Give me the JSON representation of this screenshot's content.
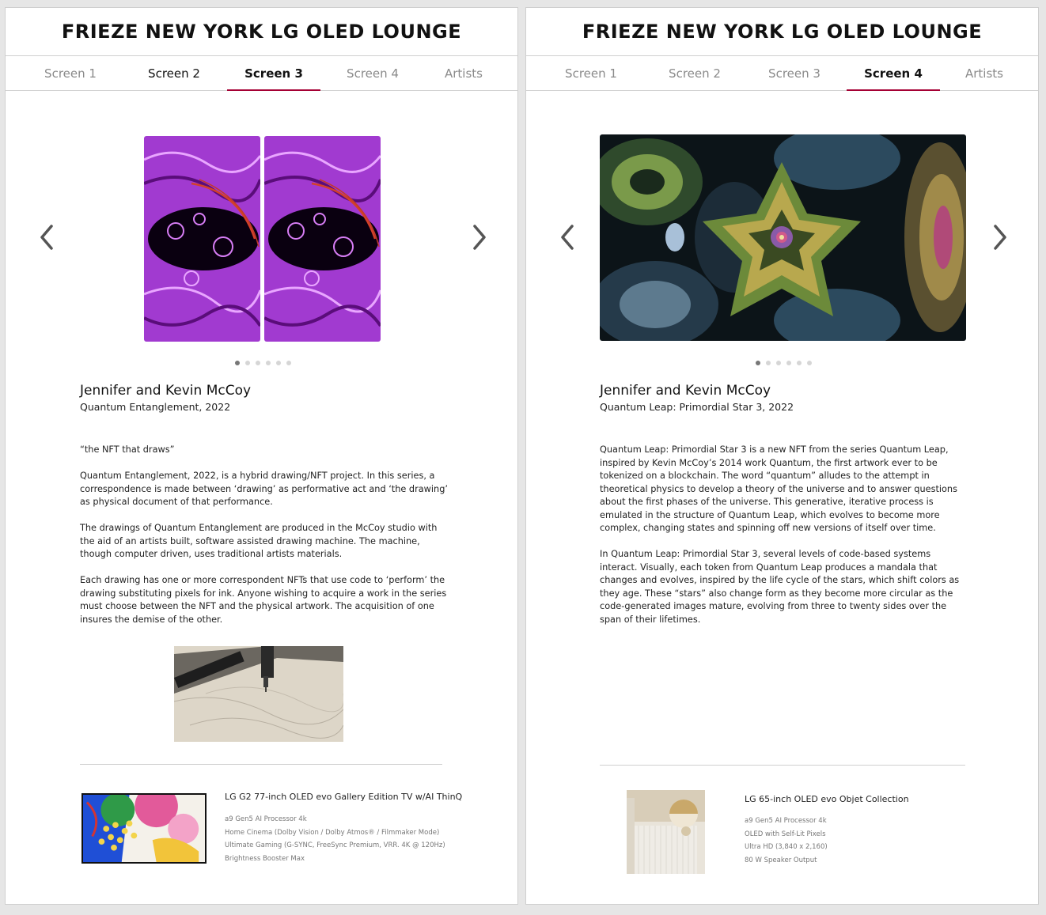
{
  "panels": [
    {
      "title": "FRIEZE NEW YORK LG OLED LOUNGE",
      "tabs": [
        "Screen 1",
        "Screen 2",
        "Screen 3",
        "Screen 4",
        "Artists"
      ],
      "active_tab": "Screen 3",
      "carousel": {
        "total": 6,
        "current": 1
      },
      "artist": "Jennifer and Kevin McCoy",
      "work": "Quantum Entanglement, 2022",
      "description": [
        "“the NFT that draws”",
        "Quantum Entanglement, 2022, is a hybrid drawing/NFT project. In this series, a correspondence is made between ‘drawing’ as performative act and ‘the drawing’ as physical document of that performance.",
        "The drawings of Quantum Entanglement are produced in the McCoy studio with the aid of an artists built, software assisted drawing machine. The machine, though computer driven, uses traditional artists materials.",
        "Each drawing has one or more correspondent NFTs that use code to ‘perform’ the drawing substituting pixels for ink. Anyone wishing to acquire a work in the series must choose between the NFT and the physical artwork. The acquisition of one insures the demise of the other."
      ],
      "product": {
        "name": "LG G2 77-inch OLED evo Gallery Edition TV w/AI ThinQ",
        "specs": [
          "a9 Gen5 AI Processor 4k",
          "Home Cinema (Dolby Vision / Dolby Atmos® / Filmmaker Mode)",
          "Ultimate Gaming (G-SYNC, FreeSync Premium, VRR. 4K @ 120Hz)",
          "Brightness Booster Max"
        ]
      }
    },
    {
      "title": "FRIEZE NEW YORK LG OLED LOUNGE",
      "tabs": [
        "Screen 1",
        "Screen 2",
        "Screen 3",
        "Screen 4",
        "Artists"
      ],
      "active_tab": "Screen 4",
      "carousel": {
        "total": 6,
        "current": 1
      },
      "artist": "Jennifer and Kevin McCoy",
      "work": "Quantum Leap: Primordial Star 3, 2022",
      "description": [
        "Quantum Leap: Primordial Star 3 is a new NFT from the series Quantum Leap, inspired by Kevin McCoy’s 2014 work Quantum, the first artwork ever to be tokenized on a blockchain. The word “quantum” alludes to the attempt in theoretical physics to develop a theory of the universe and to answer questions about the first phases of the universe. This generative, iterative process is emulated in the structure of Quantum Leap, which evolves to become more complex, changing states and spinning off new versions of itself over time.",
        "In Quantum Leap: Primordial Star 3, several levels of code-based systems interact. Visually, each token from Quantum Leap produces a mandala that changes and evolves, inspired by the life cycle of the stars, which shift colors as they age. These “stars” also change form as they become more circular as the code-generated images mature, evolving from three to twenty sides over the span of their lifetimes."
      ],
      "product": {
        "name": "LG 65-inch OLED evo Objet Collection",
        "specs": [
          "a9 Gen5 AI Processor 4k",
          "OLED with Self-Lit Pixels",
          "Ultra HD (3,840 x 2,160)",
          "80 W Speaker Output"
        ]
      }
    }
  ],
  "colors": {
    "accent": "#a50034",
    "text": "#111111",
    "muted": "#8a8a8a",
    "divider": "#cfcfcf"
  },
  "icons": {
    "prev": "chevron-left-icon",
    "next": "chevron-right-icon"
  }
}
